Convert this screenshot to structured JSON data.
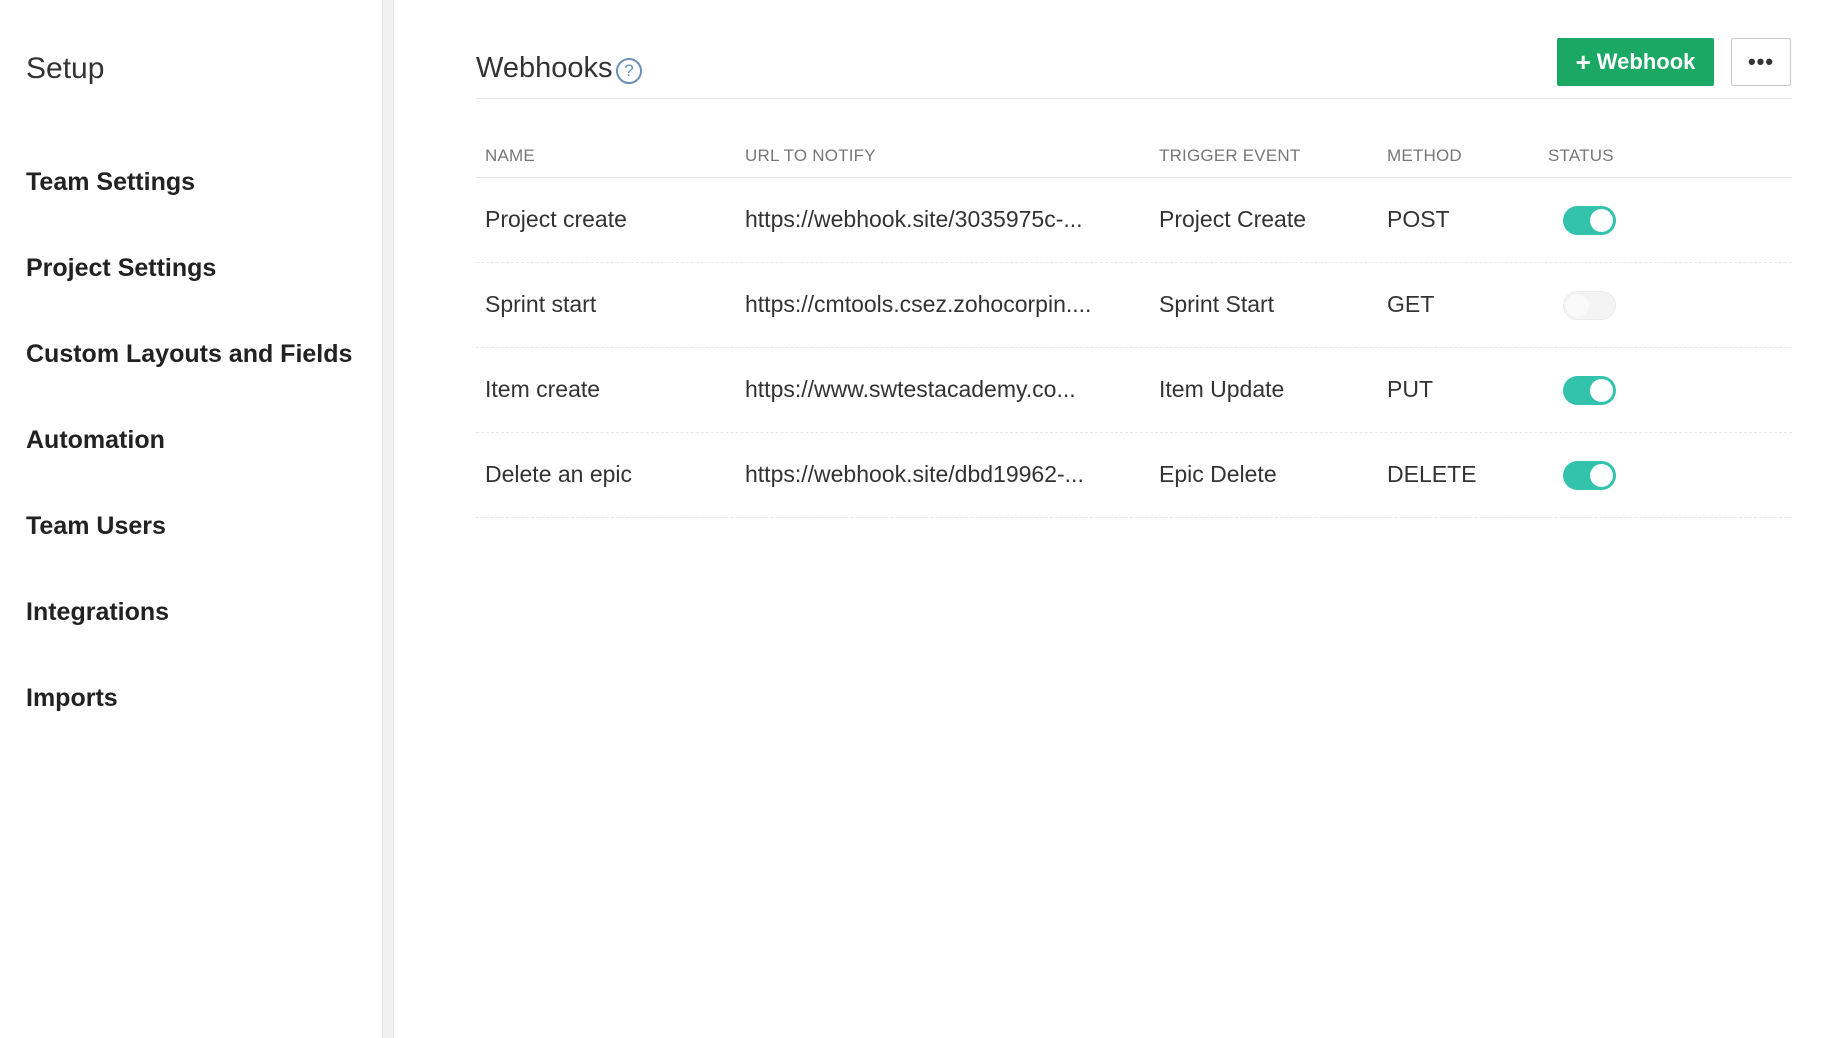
{
  "sidebar": {
    "title": "Setup",
    "items": [
      {
        "label": "Team Settings"
      },
      {
        "label": "Project Settings"
      },
      {
        "label": "Custom Layouts and Fields"
      },
      {
        "label": "Automation"
      },
      {
        "label": "Team Users"
      },
      {
        "label": "Integrations"
      },
      {
        "label": "Imports"
      }
    ]
  },
  "header": {
    "title": "Webhooks",
    "help_icon": "question-circle-icon",
    "help_glyph": "?",
    "add_button_label": "Webhook",
    "add_button_plus": "+",
    "more_glyph": "•••"
  },
  "colors": {
    "primary_button": "#1aa864",
    "toggle_on": "#33c3ad",
    "toggle_off": "#f4f4f4"
  },
  "table": {
    "columns": {
      "name": "NAME",
      "url": "URL TO NOTIFY",
      "trigger": "TRIGGER EVENT",
      "method": "METHOD",
      "status": "STATUS"
    },
    "rows": [
      {
        "name": "Project create",
        "url": "https://webhook.site/3035975c-...",
        "trigger": "Project Create",
        "method": "POST",
        "status": "on"
      },
      {
        "name": "Sprint start",
        "url": "https://cmtools.csez.zohocorpin....",
        "trigger": "Sprint Start",
        "method": "GET",
        "status": "off"
      },
      {
        "name": "Item create",
        "url": "https://www.swtestacademy.co...",
        "trigger": "Item Update",
        "method": "PUT",
        "status": "on"
      },
      {
        "name": "Delete an epic",
        "url": "https://webhook.site/dbd19962-...",
        "trigger": "Epic Delete",
        "method": "DELETE",
        "status": "on"
      }
    ]
  }
}
